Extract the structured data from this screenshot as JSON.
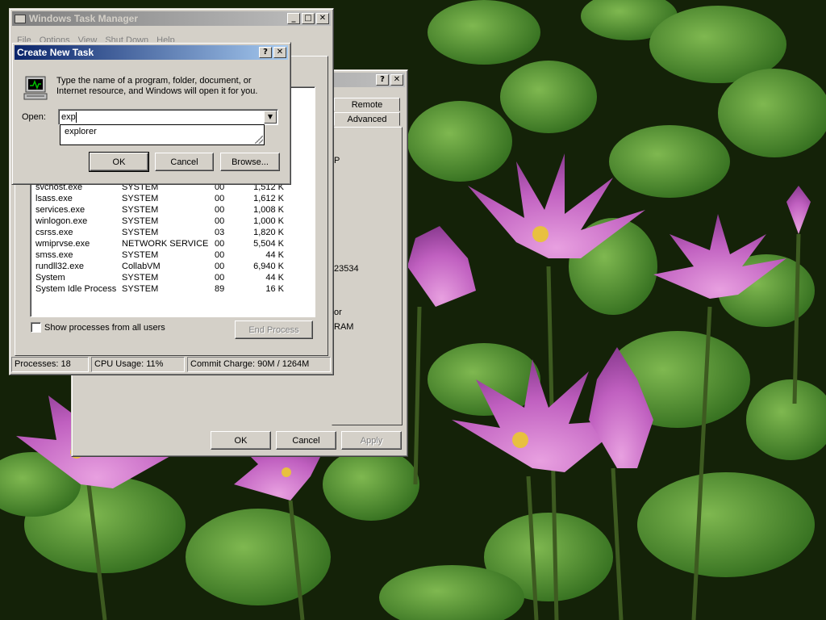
{
  "background_window": {
    "tabs": [
      "Remote",
      "Advanced"
    ],
    "fragments": [
      "P",
      "23534",
      "or",
      "RAM"
    ],
    "buttons": {
      "ok": "OK",
      "cancel": "Cancel",
      "apply": "Apply"
    }
  },
  "task_manager": {
    "title": "Windows Task Manager",
    "menu": [
      "File",
      "Options",
      "View",
      "Shut Down",
      "Help"
    ],
    "processes": [
      {
        "name": "svchost.exe",
        "user": "SYSTEM",
        "cpu": "00",
        "mem": "1,512 K"
      },
      {
        "name": "lsass.exe",
        "user": "SYSTEM",
        "cpu": "00",
        "mem": "1,612 K"
      },
      {
        "name": "services.exe",
        "user": "SYSTEM",
        "cpu": "00",
        "mem": "1,008 K"
      },
      {
        "name": "winlogon.exe",
        "user": "SYSTEM",
        "cpu": "00",
        "mem": "1,000 K"
      },
      {
        "name": "csrss.exe",
        "user": "SYSTEM",
        "cpu": "03",
        "mem": "1,820 K"
      },
      {
        "name": "wmiprvse.exe",
        "user": "NETWORK SERVICE",
        "cpu": "00",
        "mem": "5,504 K"
      },
      {
        "name": "smss.exe",
        "user": "SYSTEM",
        "cpu": "00",
        "mem": "44 K"
      },
      {
        "name": "rundll32.exe",
        "user": "CollabVM",
        "cpu": "00",
        "mem": "6,940 K"
      },
      {
        "name": "System",
        "user": "SYSTEM",
        "cpu": "00",
        "mem": "44 K"
      },
      {
        "name": "System Idle Process",
        "user": "SYSTEM",
        "cpu": "89",
        "mem": "16 K"
      }
    ],
    "show_all_label": "Show processes from all users",
    "end_process_label": "End Process",
    "status": {
      "processes": "Processes: 18",
      "cpu": "CPU Usage: 11%",
      "commit": "Commit Charge: 90M / 1264M"
    }
  },
  "create_task": {
    "title": "Create New Task",
    "description_line1": "Type the name of a program, folder, document, or",
    "description_line2": "Internet resource, and Windows will open it for you.",
    "open_label": "Open:",
    "input_value": "exp",
    "suggestion": "explorer",
    "buttons": {
      "ok": "OK",
      "cancel": "Cancel",
      "browse": "Browse..."
    }
  }
}
